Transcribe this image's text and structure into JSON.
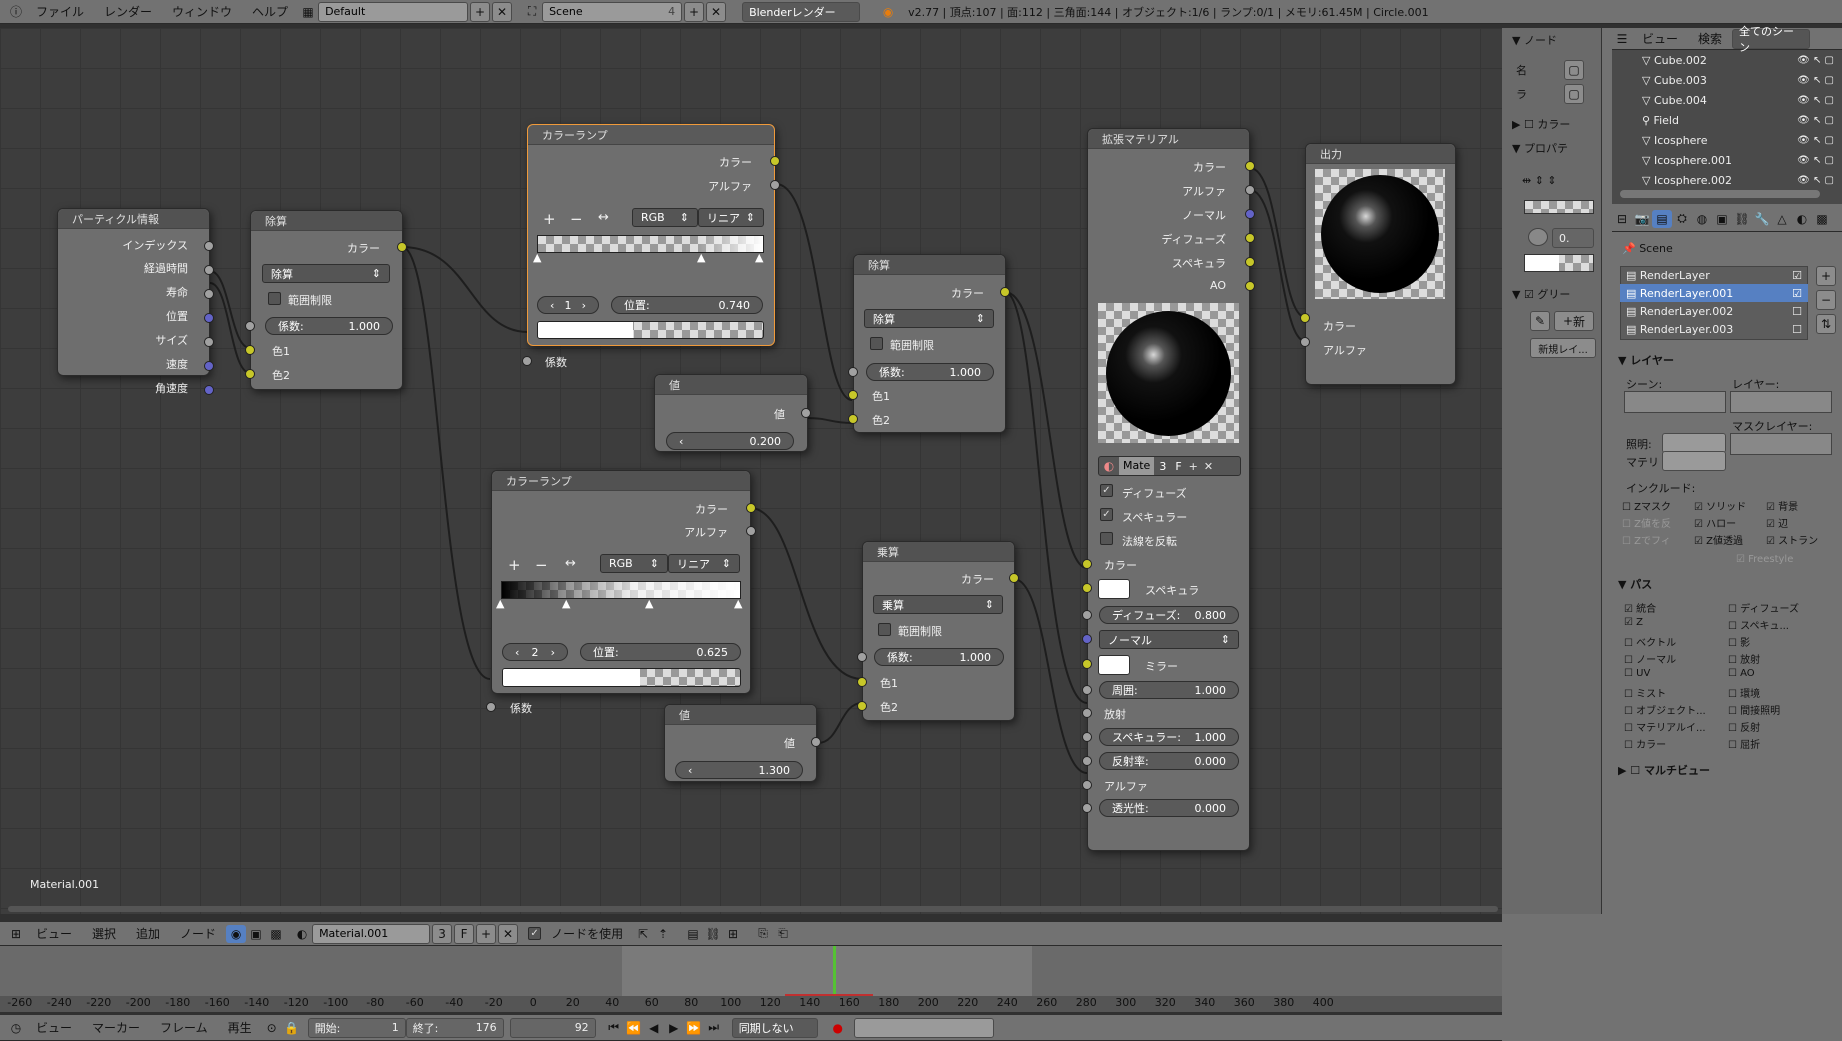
{
  "topbar": {
    "menus": [
      "ファイル",
      "レンダー",
      "ウィンドウ",
      "ヘルプ"
    ],
    "layout": "Default",
    "scene": "Scene",
    "scene_num": "4",
    "engine": "Blenderレンダー",
    "stats": "v2.77 | 頂点:107 | 面:112 | 三角面:144 | オブジェクト:1/6 | ランプ:0/1 | メモリ:61.45M | Circle.001"
  },
  "nodes": {
    "particle": {
      "title": "パーティクル情報",
      "outputs": [
        "インデックス",
        "経過時間",
        "寿命",
        "位置",
        "サイズ",
        "速度",
        "角速度"
      ]
    },
    "div1": {
      "title": "除算",
      "out": "カラー",
      "mode": "除算",
      "clamp": "範囲制限",
      "factor": "係数:",
      "factor_val": "1.000",
      "in1": "色1",
      "in2": "色2"
    },
    "ramp1": {
      "title": "カラーランプ",
      "out1": "カラー",
      "out2": "アルファ",
      "plus": "+",
      "minus": "−",
      "flip": "↔",
      "color_mode": "RGB",
      "interp": "リニア",
      "index": "1",
      "pos_label": "位置:",
      "pos_val": "0.740",
      "in": "係数"
    },
    "val1": {
      "title": "値",
      "out": "値",
      "val": "0.200"
    },
    "div2": {
      "title": "除算",
      "out": "カラー",
      "mode": "除算",
      "clamp": "範囲制限",
      "factor": "係数:",
      "factor_val": "1.000",
      "in1": "色1",
      "in2": "色2"
    },
    "ramp2": {
      "title": "カラーランプ",
      "out1": "カラー",
      "out2": "アルファ",
      "plus": "+",
      "minus": "−",
      "flip": "↔",
      "color_mode": "RGB",
      "interp": "リニア",
      "index": "2",
      "pos_label": "位置:",
      "pos_val": "0.625",
      "in": "係数"
    },
    "mult": {
      "title": "乗算",
      "out": "カラー",
      "mode": "乗算",
      "clamp": "範囲制限",
      "factor": "係数:",
      "factor_val": "1.000",
      "in1": "色1",
      "in2": "色2"
    },
    "val2": {
      "title": "値",
      "out": "値",
      "val": "1.300"
    },
    "mat": {
      "title": "拡張マテリアル",
      "outputs": [
        "カラー",
        "アルファ",
        "ノーマル",
        "ディフューズ",
        "スペキュラ",
        "AO"
      ],
      "mat_name": "Mate",
      "mat_users": "3",
      "mat_f": "F",
      "diffuse": "ディフューズ",
      "specular": "スペキュラー",
      "invert": "法線を反転",
      "in_color": "カラー",
      "spec_label": "スペキュラ",
      "diff_factor": "ディフューズ:",
      "diff_val": "0.800",
      "normal": "ノーマル",
      "mirror": "ミラー",
      "ambient": "周囲:",
      "ambient_val": "1.000",
      "emit": "放射",
      "spec_amt": "スペキュラー:",
      "spec_amt_val": "1.000",
      "refl": "反射率:",
      "refl_val": "0.000",
      "alpha": "アルファ",
      "trans": "透光性:",
      "trans_val": "0.000"
    },
    "out": {
      "title": "出力",
      "in1": "カラー",
      "in2": "アルファ"
    }
  },
  "editor_label": "Material.001",
  "node_header": {
    "menus": [
      "ビュー",
      "選択",
      "追加",
      "ノード"
    ],
    "material": "Material.001",
    "users": "3",
    "f": "F",
    "use_nodes": "ノードを使用"
  },
  "timeline": {
    "ticks": [
      "-260",
      "-240",
      "-220",
      "-200",
      "-180",
      "-160",
      "-140",
      "-120",
      "-100",
      "-80",
      "-60",
      "-40",
      "-20",
      "0",
      "20",
      "40",
      "60",
      "80",
      "100",
      "120",
      "140",
      "160",
      "180",
      "200",
      "220",
      "240",
      "260",
      "280",
      "300",
      "320",
      "340",
      "360",
      "380",
      "400"
    ],
    "menus": [
      "ビュー",
      "マーカー",
      "フレーム",
      "再生"
    ],
    "start": "開始:",
    "start_val": "1",
    "end": "終了:",
    "end_val": "176",
    "current": "92",
    "sync": "同期しない"
  },
  "props": {
    "node_label": "ノード",
    "name_label": "名",
    "label_label": "ラ",
    "color_label": "カラー",
    "prop_label": "プロパテ",
    "grease": "グリー",
    "new": "新",
    "new_layer": "新規レイ...",
    "slider_val": "0.",
    "outliner": {
      "view": "ビュー",
      "search": "検索",
      "all_scenes": "全てのシーン",
      "items": [
        "Cube.002",
        "Cube.003",
        "Cube.004",
        "Field",
        "Icosphere",
        "Icosphere.001",
        "Icosphere.002"
      ]
    },
    "scene": "Scene",
    "render_layers": [
      "RenderLayer",
      "RenderLayer.001",
      "RenderLayer.002",
      "RenderLayer.003"
    ],
    "layer_section": "レイヤー",
    "scene_label": "シーン:",
    "layer_label": "レイヤー:",
    "mask_layer": "マスクレイヤー:",
    "light": "照明:",
    "mat": "マテリ",
    "include": "インクルード:",
    "include_items": [
      "Zマスク",
      "ソリッド",
      "背景",
      "Z値を反",
      "ハロー",
      "辺",
      "Zでフィ",
      "Z値透過",
      "ストラン",
      "Freestyle"
    ],
    "pass": "パス",
    "pass_left": [
      "統合",
      "Z",
      "ベクトル",
      "ノーマル",
      "UV",
      "ミスト",
      "オブジェクト...",
      "マテリアルイ...",
      "カラー"
    ],
    "pass_right": [
      "ディフューズ",
      "スペキュ...",
      "影",
      "放射",
      "AO",
      "環境",
      "間接照明",
      "反射",
      "屈折"
    ],
    "multiview": "マルチビュー"
  }
}
